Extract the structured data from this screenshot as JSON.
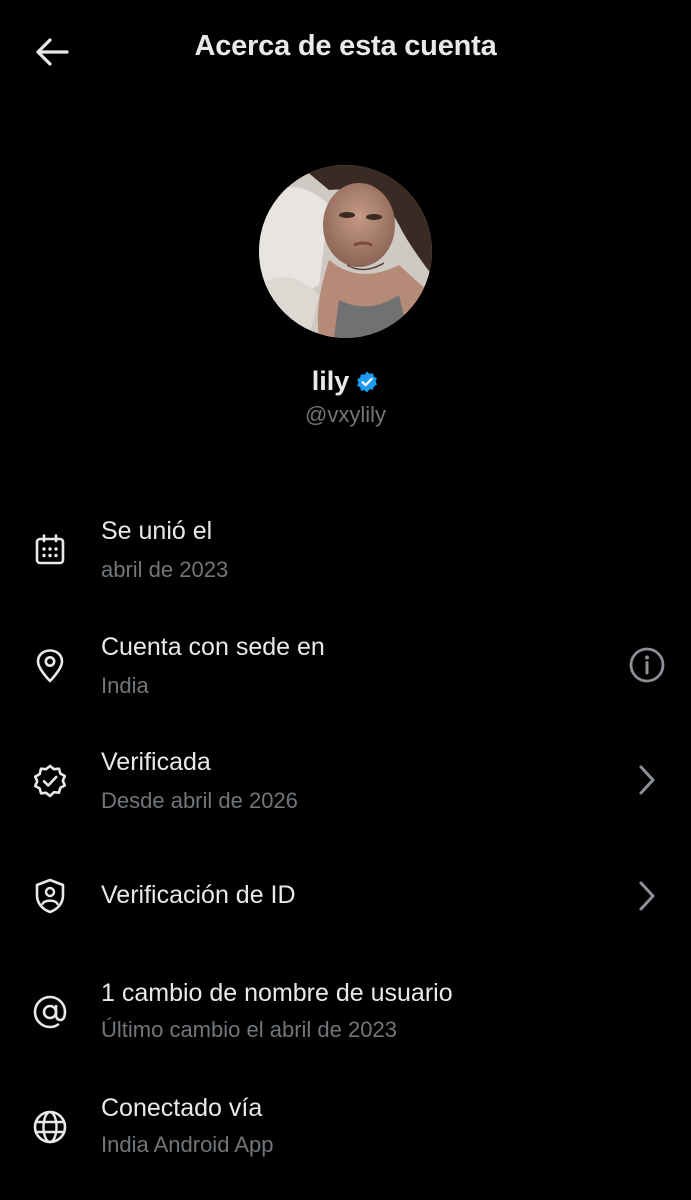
{
  "header": {
    "title": "Acerca de esta cuenta",
    "back_icon": "arrow-left-icon"
  },
  "profile": {
    "display_name": "lily",
    "handle": "@vxylily",
    "verified_badge_color": "#1d9bf0",
    "avatar_icon": "profile-photo"
  },
  "rows": [
    {
      "icon": "calendar-icon",
      "title": "Se unió el",
      "subtitle": "abril de 2023"
    },
    {
      "icon": "location-pin-icon",
      "title": "Cuenta con sede en",
      "subtitle": "India",
      "action": "info-icon"
    },
    {
      "icon": "verified-seal-icon",
      "title": "Verificada",
      "subtitle": "Desde abril de 2026",
      "action": "chevron-right-icon"
    },
    {
      "icon": "shield-user-icon",
      "title": "Verificación de ID",
      "action": "chevron-right-icon"
    },
    {
      "icon": "at-sign-icon",
      "title": "1 cambio de nombre de usuario",
      "subtitle": "Último cambio el abril de 2023"
    },
    {
      "icon": "globe-icon",
      "title": "Conectado vía",
      "subtitle": "India Android App"
    }
  ],
  "colors": {
    "background": "#000000",
    "text": "#e7e9ea",
    "muted": "#71767b",
    "accent": "#1d9bf0"
  }
}
